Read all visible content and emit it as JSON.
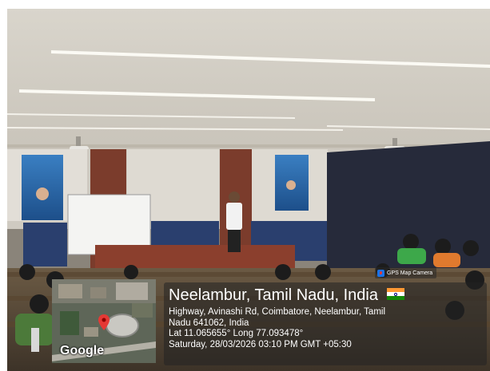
{
  "photo": {
    "subject": "lecture hall with speaker presenting to audience"
  },
  "gps_overlay": {
    "app_badge": "GPS Map Camera",
    "icon": "gps-map-camera-icon",
    "map_brand": "Google",
    "title": "Neelambur, Tamil Nadu, India",
    "flag": "india-flag",
    "address_line1": "Highway, Avinashi Rd, Coimbatore, Neelambur, Tamil",
    "address_line2": "Nadu 641062, India",
    "coords": "Lat 11.065655° Long 77.093478°",
    "datetime": "Saturday, 28/03/2026 03:10 PM GMT +05:30",
    "colors": {
      "flag_saffron": "#ff9933",
      "flag_white": "#ffffff",
      "flag_green": "#138808",
      "pin": "#e53935"
    }
  }
}
